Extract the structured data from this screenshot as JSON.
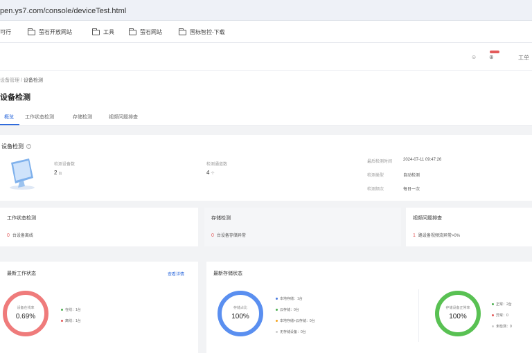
{
  "browser": {
    "url": "pen.ys7.com/console/deviceTest.html",
    "bookmarks": [
      "可行",
      "萤石开放网站",
      "工具",
      "萤石网站",
      "国标智控-下载"
    ]
  },
  "app": {
    "top_icons": [
      "☺",
      "⊕",
      "工单"
    ]
  },
  "page": {
    "breadcrumb": [
      "设备管理",
      "设备检测"
    ],
    "title": "设备检测",
    "tabs": [
      "概览",
      "工作状态检测",
      "存储检测",
      "视频问题排查"
    ]
  },
  "overview": {
    "title": "设备检测",
    "fields": [
      {
        "label": "检测设备数",
        "value": "2",
        "unit": "台"
      },
      {
        "label": "检测通道数",
        "value": "4",
        "unit": "个"
      }
    ],
    "meta": [
      {
        "label": "最后检测时间",
        "value": "2024-07-11 09:47:26"
      },
      {
        "label": "检测类型",
        "value": "自动检测"
      },
      {
        "label": "检测频次",
        "value": "每日一次"
      }
    ]
  },
  "stats": [
    {
      "title": "工作状态检测",
      "count": "0",
      "desc": "台设备离线"
    },
    {
      "title": "存储检测",
      "count": "0",
      "desc": "台设备存储异常"
    },
    {
      "title": "视频问题排查",
      "count": "1",
      "desc": "路设备视频流异常>0%"
    }
  ],
  "cards": {
    "work_status": {
      "title": "最新工作状态",
      "link": "查看详情",
      "ring_label": "设备在线率",
      "ring_value": "0.69%",
      "ring_fraction": 0.0069,
      "legend": [
        {
          "label": "在线：1台",
          "color": "#4caf50"
        },
        {
          "label": "离线：1台",
          "color": "#e35a5a"
        }
      ]
    },
    "storage": {
      "title": "最新存储状态",
      "ring_label": "存储占比",
      "ring_value": "100%",
      "ring_fraction": 1.0,
      "legend": [
        {
          "label": "本地存储：1台",
          "color": "#4a7be0"
        },
        {
          "label": "云存储：0台",
          "color": "#4caf50"
        },
        {
          "label": "本地存储+云存储：0台",
          "color": "#f5a623"
        },
        {
          "label": "无存储设备：0台",
          "color": "#cccccc"
        }
      ]
    },
    "storage_health": {
      "ring_label": "存储设备正常率",
      "ring_value": "100%",
      "ring_fraction": 1.0,
      "legend": [
        {
          "label": "正常：2台",
          "color": "#4caf50"
        },
        {
          "label": "异常：0",
          "color": "#e35a5a"
        },
        {
          "label": "未检测：0",
          "color": "#cccccc"
        }
      ]
    }
  },
  "colors": {
    "accent": "#2f6bdc",
    "danger": "#e35a5a",
    "success": "#4caf50",
    "ring_red": "#ef7b7b",
    "ring_blue": "#5a8ff0",
    "ring_green": "#59c153"
  }
}
